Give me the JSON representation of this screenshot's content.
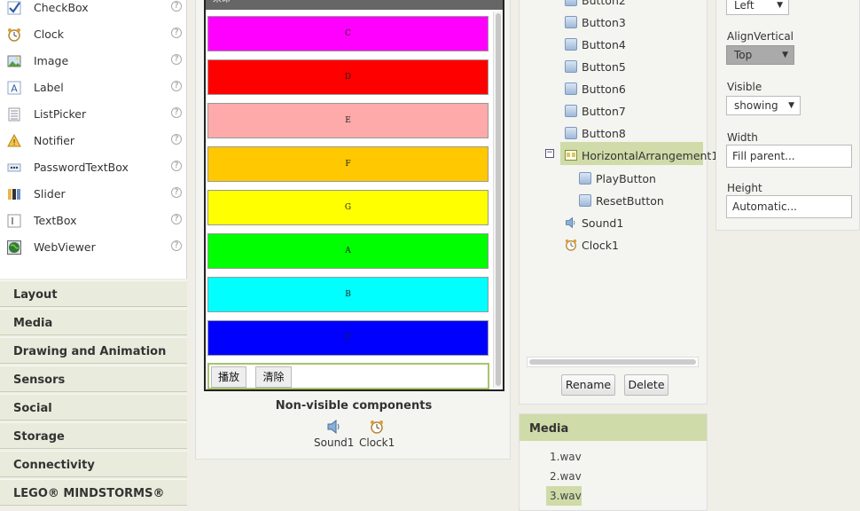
{
  "palette": {
    "items": [
      {
        "label": "CheckBox",
        "icon": "checkbox-icon"
      },
      {
        "label": "Clock",
        "icon": "clock-icon"
      },
      {
        "label": "Image",
        "icon": "image-icon"
      },
      {
        "label": "Label",
        "icon": "label-icon"
      },
      {
        "label": "ListPicker",
        "icon": "listpicker-icon"
      },
      {
        "label": "Notifier",
        "icon": "notifier-icon"
      },
      {
        "label": "PasswordTextBox",
        "icon": "password-icon"
      },
      {
        "label": "Slider",
        "icon": "slider-icon"
      },
      {
        "label": "TextBox",
        "icon": "textbox-icon"
      },
      {
        "label": "WebViewer",
        "icon": "webviewer-icon"
      }
    ],
    "help_glyph": "?",
    "categories": [
      "Layout",
      "Media",
      "Drawing and Animation",
      "Sensors",
      "Social",
      "Storage",
      "Connectivity",
      "LEGO® MINDSTORMS®"
    ]
  },
  "viewer": {
    "screen_title": "未命",
    "note_buttons": [
      {
        "label": "C",
        "color": "#ff00ff"
      },
      {
        "label": "D",
        "color": "#ff0000"
      },
      {
        "label": "E",
        "color": "#ffaaaa"
      },
      {
        "label": "F",
        "color": "#ffc800"
      },
      {
        "label": "G",
        "color": "#ffff00"
      },
      {
        "label": "A",
        "color": "#00ff00"
      },
      {
        "label": "B",
        "color": "#00ffff"
      },
      {
        "label": "C",
        "color": "#0000ff"
      }
    ],
    "play_button": "播放",
    "reset_button": "清除",
    "nonvisible_title": "Non-visible components",
    "nonvisible": [
      {
        "label": "Sound1",
        "icon": "sound-icon"
      },
      {
        "label": "Clock1",
        "icon": "clock-icon"
      }
    ]
  },
  "components": {
    "items": [
      "Button2",
      "Button3",
      "Button4",
      "Button5",
      "Button6",
      "Button7",
      "Button8",
      "HorizontalArrangement1",
      "PlayButton",
      "ResetButton",
      "Sound1",
      "Clock1"
    ],
    "selected": "HorizontalArrangement1",
    "collapse_glyph": "⊟",
    "rename_label": "Rename",
    "delete_label": "Delete"
  },
  "media": {
    "title": "Media",
    "files": [
      "1.wav",
      "2.wav",
      "3.wav"
    ],
    "selected": "3.wav"
  },
  "properties": {
    "align_horizontal_value": "Left",
    "align_vertical_label": "AlignVertical",
    "align_vertical_value": "Top",
    "visible_label": "Visible",
    "visible_value": "showing",
    "width_label": "Width",
    "width_value": "Fill parent...",
    "height_label": "Height",
    "height_value": "Automatic..."
  },
  "colors": {
    "accent_green": "#cfdba8",
    "category_bg": "#e9ecdc"
  }
}
